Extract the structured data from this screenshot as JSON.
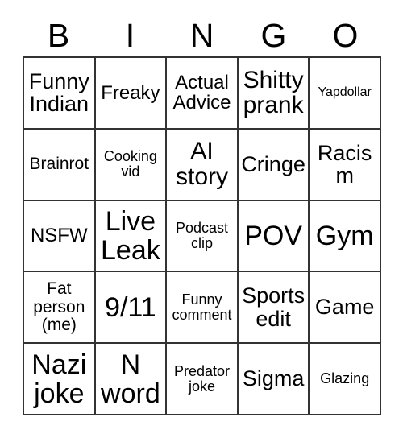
{
  "card": {
    "title": "BINGO",
    "header_letters": [
      "B",
      "I",
      "N",
      "G",
      "O"
    ],
    "colors": {
      "grid_line": "#333333",
      "text": "#000000",
      "background": "#ffffff"
    },
    "grid": {
      "columns": 5,
      "rows": 5,
      "cells": [
        {
          "text": "Funny\nIndian",
          "size": "lg"
        },
        {
          "text": "Freaky",
          "size": "md"
        },
        {
          "text": "Actual\nAdvice",
          "size": "md"
        },
        {
          "text": "Shitty\nprank",
          "size": "xl"
        },
        {
          "text": "Yapdollar",
          "size": "xxs"
        },
        {
          "text": "Brainrot",
          "size": "sm"
        },
        {
          "text": "Cooking\nvid",
          "size": "xs"
        },
        {
          "text": "AI\nstory",
          "size": "xl"
        },
        {
          "text": "Cringe",
          "size": "lg"
        },
        {
          "text": "Racism",
          "size": "lg"
        },
        {
          "text": "NSFW",
          "size": "md"
        },
        {
          "text": "Live\nLeak",
          "size": "xxl"
        },
        {
          "text": "Podcast\nclip",
          "size": "xs"
        },
        {
          "text": "POV",
          "size": "xxl"
        },
        {
          "text": "Gym",
          "size": "xxl"
        },
        {
          "text": "Fat\nperson\n(me)",
          "size": "sm"
        },
        {
          "text": "9/11",
          "size": "xxl"
        },
        {
          "text": "Funny\ncomment",
          "size": "xs"
        },
        {
          "text": "Sports\nedit",
          "size": "lg"
        },
        {
          "text": "Game",
          "size": "lg"
        },
        {
          "text": "Nazi\njoke",
          "size": "xxl"
        },
        {
          "text": "N\nword",
          "size": "xxl"
        },
        {
          "text": "Predator\njoke",
          "size": "xs"
        },
        {
          "text": "Sigma",
          "size": "lg"
        },
        {
          "text": "Glazing",
          "size": "xs"
        }
      ]
    }
  }
}
